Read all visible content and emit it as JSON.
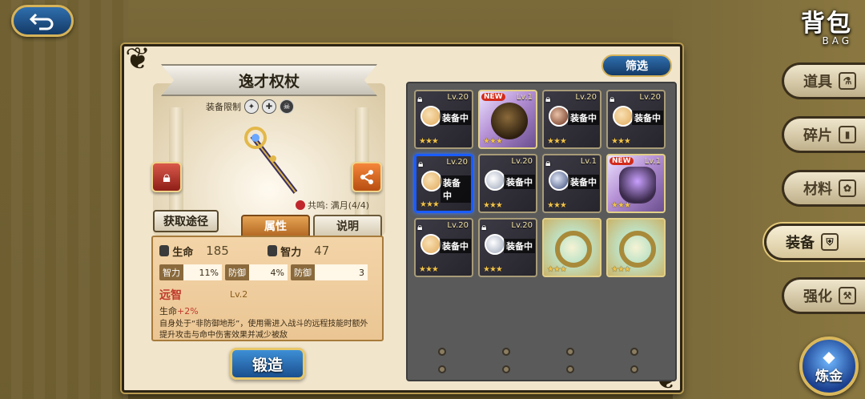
{
  "header": {
    "title": "背包",
    "subtitle": "BAG"
  },
  "detail": {
    "item_name": "逸才权杖",
    "equip_limit_label": "装备限制",
    "resonance_label": "共鸣:",
    "resonance_value": "满月(4/4)",
    "source_button": "获取途径",
    "tabs": {
      "attributes": "属性",
      "description": "说明"
    },
    "stats": {
      "hp_label": "生命",
      "hp_value": "185",
      "int_label": "智力",
      "int_value": "47"
    },
    "substats": [
      {
        "k": "智力",
        "v": "11%"
      },
      {
        "k": "防御",
        "v": "4%"
      },
      {
        "k": "防御",
        "v": "3"
      }
    ],
    "skill": {
      "name": "远智",
      "level": "Lv.2",
      "effect_prefix": "生命",
      "effect_value": "+2%",
      "description": "自身处于“非防御地形”，使用需进入战斗的远程技能时额外提升攻击与命中伤害效果并减少被敌"
    },
    "forge_button": "锻造"
  },
  "filter_button": "筛选",
  "equipped_label": "装备中",
  "new_label": "NEW",
  "cards": [
    {
      "lv": "Lv.20",
      "locked": true,
      "equipped": true,
      "type": "char",
      "avatar": "gold",
      "stars": "★★★"
    },
    {
      "lv": "Lv.1",
      "locked": false,
      "new": true,
      "type": "purple",
      "art": "beetle",
      "stars": "★★★"
    },
    {
      "lv": "Lv.20",
      "locked": true,
      "equipped": true,
      "type": "char",
      "avatar": "dark",
      "stars": "★★★"
    },
    {
      "lv": "Lv.20",
      "locked": true,
      "equipped": true,
      "type": "char",
      "avatar": "gold",
      "stars": "★★★"
    },
    {
      "lv": "Lv.20",
      "locked": true,
      "equipped": true,
      "type": "char",
      "avatar": "gold",
      "stars": "★★★",
      "selected": true
    },
    {
      "lv": "Lv.20",
      "locked": false,
      "equipped": true,
      "type": "char",
      "avatar": "silver",
      "stars": "★★★"
    },
    {
      "lv": "Lv.1",
      "locked": true,
      "equipped": true,
      "type": "char",
      "avatar": "blue",
      "stars": "★★★"
    },
    {
      "lv": "Lv.1",
      "locked": false,
      "new": true,
      "type": "purple",
      "art": "armor",
      "stars": "★★★"
    },
    {
      "lv": "Lv.20",
      "locked": true,
      "equipped": true,
      "type": "char",
      "avatar": "gold",
      "stars": "★★★"
    },
    {
      "lv": "Lv.20",
      "locked": true,
      "equipped": true,
      "type": "char",
      "avatar": "silver",
      "stars": "★★★"
    },
    {
      "lv": "",
      "locked": false,
      "type": "gold",
      "art": "ring",
      "stars": "★★★"
    },
    {
      "lv": "",
      "locked": false,
      "type": "gold",
      "art": "ring",
      "stars": "★★★"
    }
  ],
  "side_menu": [
    {
      "label": "道具",
      "active": false
    },
    {
      "label": "碎片",
      "active": false
    },
    {
      "label": "材料",
      "active": false
    },
    {
      "label": "装备",
      "active": true
    },
    {
      "label": "强化",
      "active": false
    }
  ],
  "alchemy_button": "炼金"
}
